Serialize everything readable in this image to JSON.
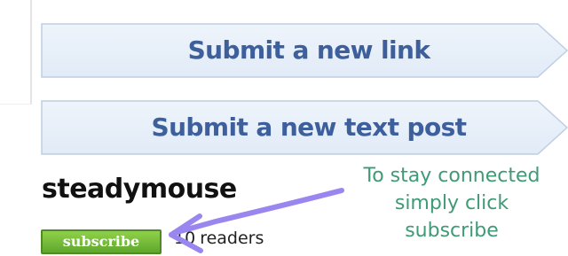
{
  "sidebar": {
    "submit_link_label": "Submit a new link",
    "submit_text_label": "Submit a new text post"
  },
  "subreddit": {
    "name": "steadymouse",
    "subscribe_label": "subscribe",
    "readers_count": "10",
    "readers_label": "readers"
  },
  "annotation": {
    "lines": [
      "To stay connected",
      "simply click",
      "subscribe"
    ]
  },
  "colors": {
    "submit_text": "#3d5f9b",
    "submit_fill": "#e6effa",
    "submit_border": "#bfcee2",
    "subscribe_green": "#5fa72d",
    "annotation_green": "#3f9a76",
    "arrow_purple": "#9a86ef"
  }
}
